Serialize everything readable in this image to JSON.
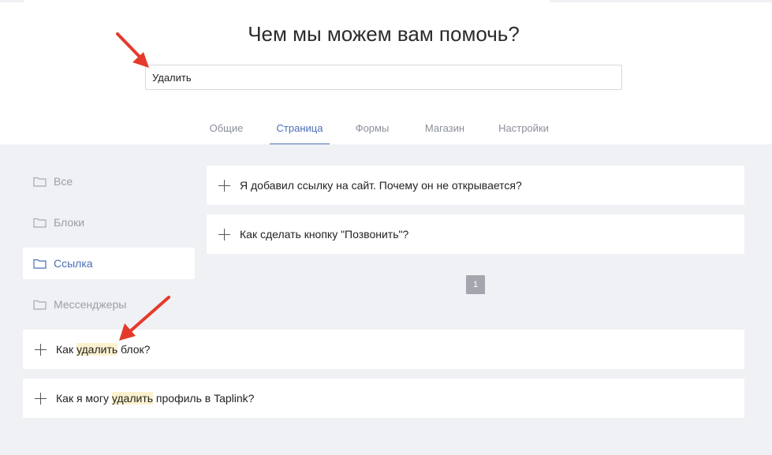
{
  "header": {
    "title": "Чем мы можем вам помочь?",
    "search_value": "Удалить"
  },
  "tabs": [
    {
      "label": "Общие",
      "active": false
    },
    {
      "label": "Страница",
      "active": true
    },
    {
      "label": "Формы",
      "active": false
    },
    {
      "label": "Магазин",
      "active": false
    },
    {
      "label": "Настройки",
      "active": false
    }
  ],
  "categories": [
    {
      "label": "Все",
      "active": false
    },
    {
      "label": "Блоки",
      "active": false
    },
    {
      "label": "Ссылка",
      "active": true
    },
    {
      "label": "Мессенджеры",
      "active": false
    }
  ],
  "questions": [
    {
      "text": "Я добавил ссылку на сайт. Почему он не открывается?"
    },
    {
      "text": "Как сделать кнопку \"Позвонить\"?"
    }
  ],
  "pagination": {
    "current": "1"
  },
  "search_results": [
    {
      "before": "Как ",
      "match": "удалить",
      "after": " блок?"
    },
    {
      "before": "Как я могу ",
      "match": "удалить",
      "after": " профиль в Taplink?"
    }
  ],
  "colors": {
    "accent": "#4a6fb5",
    "arrow": "#e53a2b",
    "highlight": "#fbf1cf"
  }
}
